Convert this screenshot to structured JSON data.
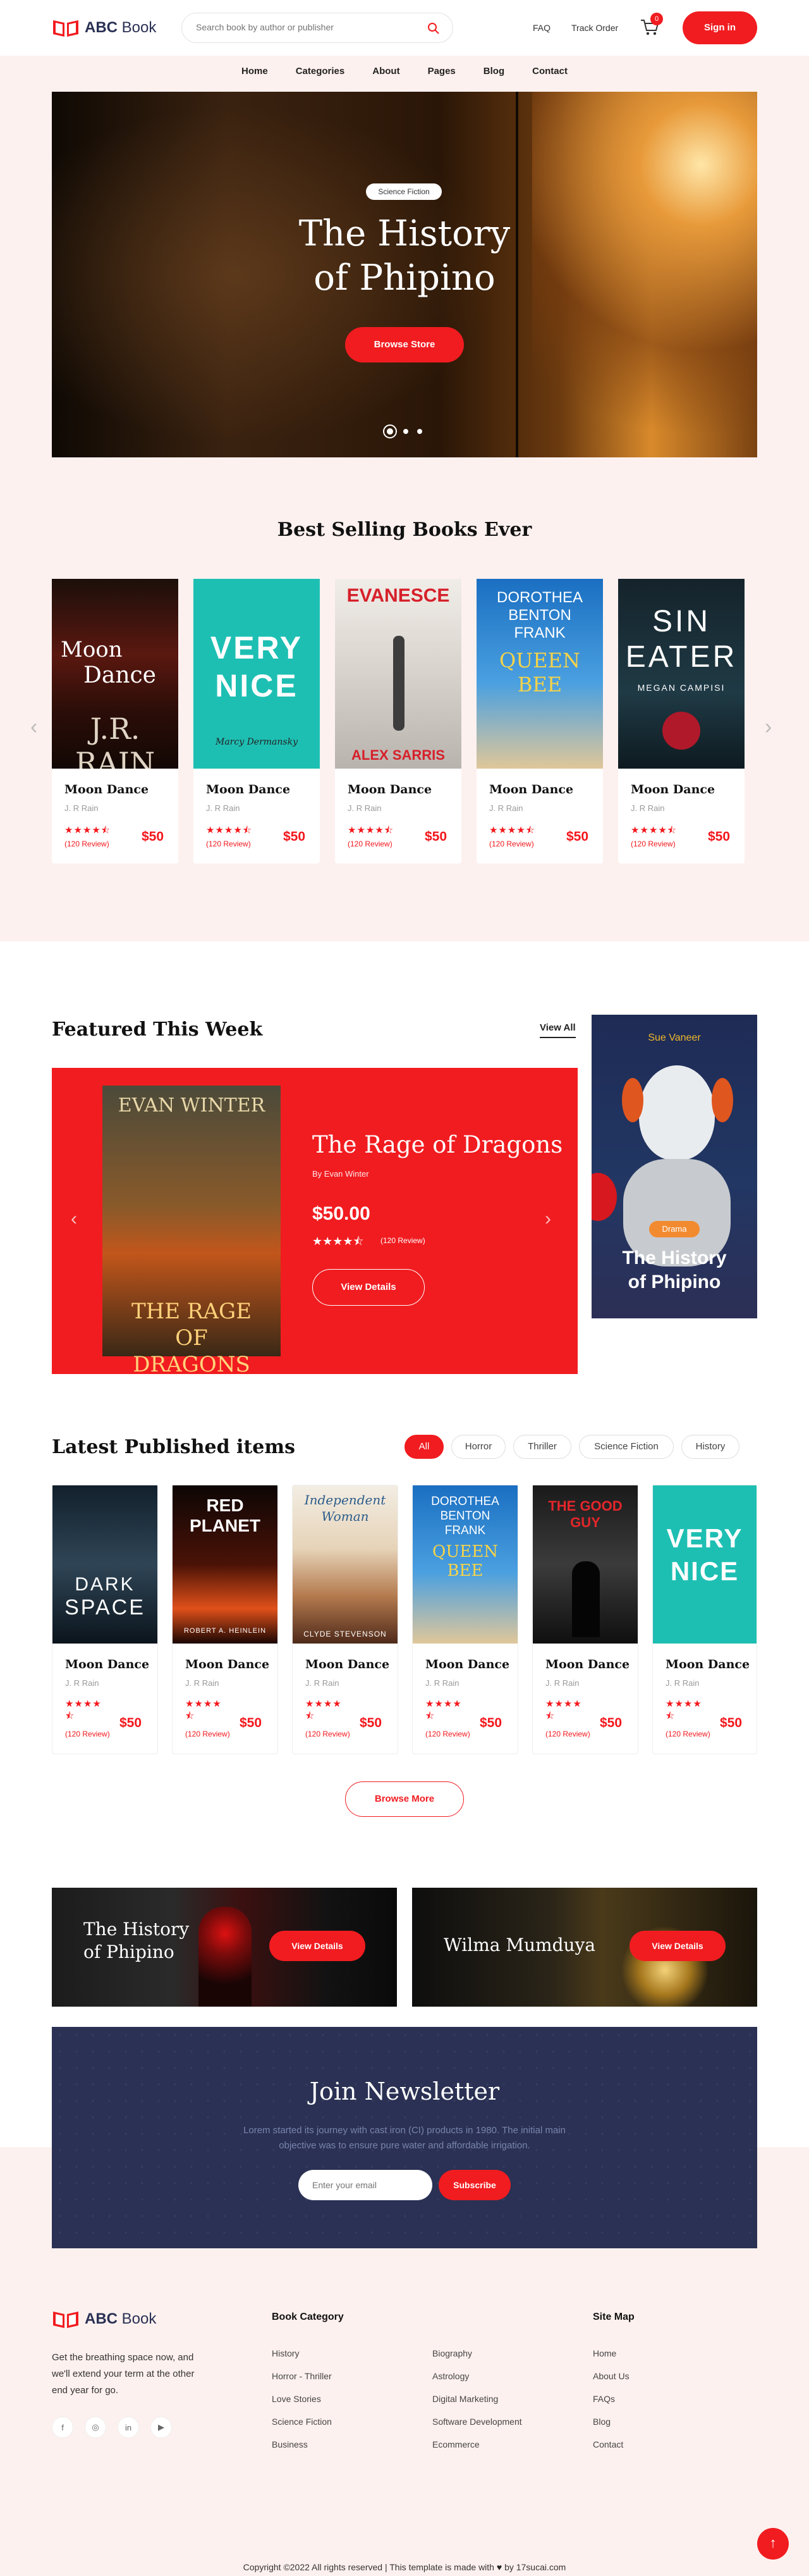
{
  "brand": {
    "name_bold": "ABC",
    "name_light": "Book"
  },
  "header": {
    "search_placeholder": "Search book by author or publisher",
    "faq": "FAQ",
    "track_order": "Track Order",
    "cart_count": "0",
    "sign_in": "Sign in"
  },
  "nav": [
    "Home",
    "Categories",
    "About",
    "Pages",
    "Blog",
    "Contact"
  ],
  "hero": {
    "badge": "Science Fiction",
    "title_line1": "The History",
    "title_line2": "of Phipino",
    "button": "Browse Store"
  },
  "best": {
    "heading": "Best Selling Books Ever",
    "books": [
      {
        "cover_top": "Moon",
        "cover_mid": "Dance",
        "cover_bottom": "J.R. RAIN",
        "title": "Moon Dance",
        "author": "J. R Rain",
        "review": "(120 Review)",
        "price": "$50"
      },
      {
        "cover_top": "VERY",
        "cover_mid": "NICE",
        "cover_bottom": "Marcy Dermansky",
        "title": "Moon Dance",
        "author": "J. R Rain",
        "review": "(120 Review)",
        "price": "$50"
      },
      {
        "cover_top": "EVANESCE",
        "cover_mid": "",
        "cover_bottom": "ALEX SARRIS",
        "title": "Moon Dance",
        "author": "J. R Rain",
        "review": "(120 Review)",
        "price": "$50"
      },
      {
        "cover_top": "DOROTHEA BENTON FRANK",
        "cover_mid": "QUEEN BEE",
        "cover_bottom": "",
        "title": "Moon Dance",
        "author": "J. R Rain",
        "review": "(120 Review)",
        "price": "$50"
      },
      {
        "cover_top": "SIN",
        "cover_mid": "EATER",
        "cover_bottom": "MEGAN CAMPISI",
        "title": "Moon Dance",
        "author": "J. R Rain",
        "review": "(120 Review)",
        "price": "$50"
      }
    ]
  },
  "featured": {
    "heading": "Featured This Week",
    "view_all": "View All",
    "book_cover_author": "EVAN WINTER",
    "book_cover_title": "THE RAGE OF DRAGONS",
    "title": "The Rage of Dragons",
    "author": "By Evan Winter",
    "price": "$50.00",
    "review": "(120 Review)",
    "button": "View Details",
    "side": {
      "author": "Sue Vaneer",
      "badge": "Drama",
      "title_line1": "The History",
      "title_line2": "of Phipino"
    }
  },
  "latest": {
    "heading": "Latest Published items",
    "filters": [
      "All",
      "Horror",
      "Thriller",
      "Science Fiction",
      "History"
    ],
    "books": [
      {
        "cover_top": "DARK",
        "cover_mid": "SPACE",
        "title": "Moon Dance",
        "author": "J. R Rain",
        "review": "(120 Review)",
        "price": "$50"
      },
      {
        "cover_top": "RED PLANET",
        "cover_mid": "ROBERT A. HEINLEIN",
        "title": "Moon Dance",
        "author": "J. R Rain",
        "review": "(120 Review)",
        "price": "$50"
      },
      {
        "cover_top": "Independent Woman",
        "cover_mid": "CLYDE STEVENSON",
        "title": "Moon Dance",
        "author": "J. R Rain",
        "review": "(120 Review)",
        "price": "$50"
      },
      {
        "cover_top": "DOROTHEA BENTON FRANK",
        "cover_mid": "QUEEN BEE",
        "title": "Moon Dance",
        "author": "J. R Rain",
        "review": "(120 Review)",
        "price": "$50"
      },
      {
        "cover_top": "THE GOOD GUY",
        "cover_mid": "",
        "title": "Moon Dance",
        "author": "J. R Rain",
        "review": "(120 Review)",
        "price": "$50"
      },
      {
        "cover_top": "VERY",
        "cover_mid": "NICE",
        "title": "Moon Dance",
        "author": "J. R Rain",
        "review": "(120 Review)",
        "price": "$50"
      }
    ],
    "browse_more": "Browse More"
  },
  "promo": [
    {
      "title_line1": "The History",
      "title_line2": "of Phipino",
      "button": "View Details"
    },
    {
      "title": "Wilma Mumduya",
      "button": "View Details"
    }
  ],
  "newsletter": {
    "heading": "Join Newsletter",
    "text_line1": "Lorem started its journey with cast iron (CI) products in 1980. The initial main",
    "text_line2": "objective was to ensure pure water and affordable irrigation.",
    "placeholder": "Enter your email",
    "button": "Subscribe"
  },
  "footer": {
    "tagline_line1": "Get the breathing space now, and",
    "tagline_line2": "we'll extend your term at the other",
    "tagline_line3": "end year for go.",
    "category_heading": "Book Category",
    "col1": [
      "History",
      "Horror - Thriller",
      "Love Stories",
      "Science Fiction",
      "Business"
    ],
    "col2": [
      "Biography",
      "Astrology",
      "Digital Marketing",
      "Software Development",
      "Ecommerce"
    ],
    "sitemap_heading": "Site Map",
    "col3": [
      "Home",
      "About Us",
      "FAQs",
      "Blog",
      "Contact"
    ],
    "copyright_a": "Copyright ©2022 All rights reserved | This template is made with",
    "copyright_b": "by 17sucai.com"
  },
  "colors": {
    "accent": "#f11c20",
    "navy": "#2a3154",
    "pink_bg": "#fdf1ef"
  }
}
